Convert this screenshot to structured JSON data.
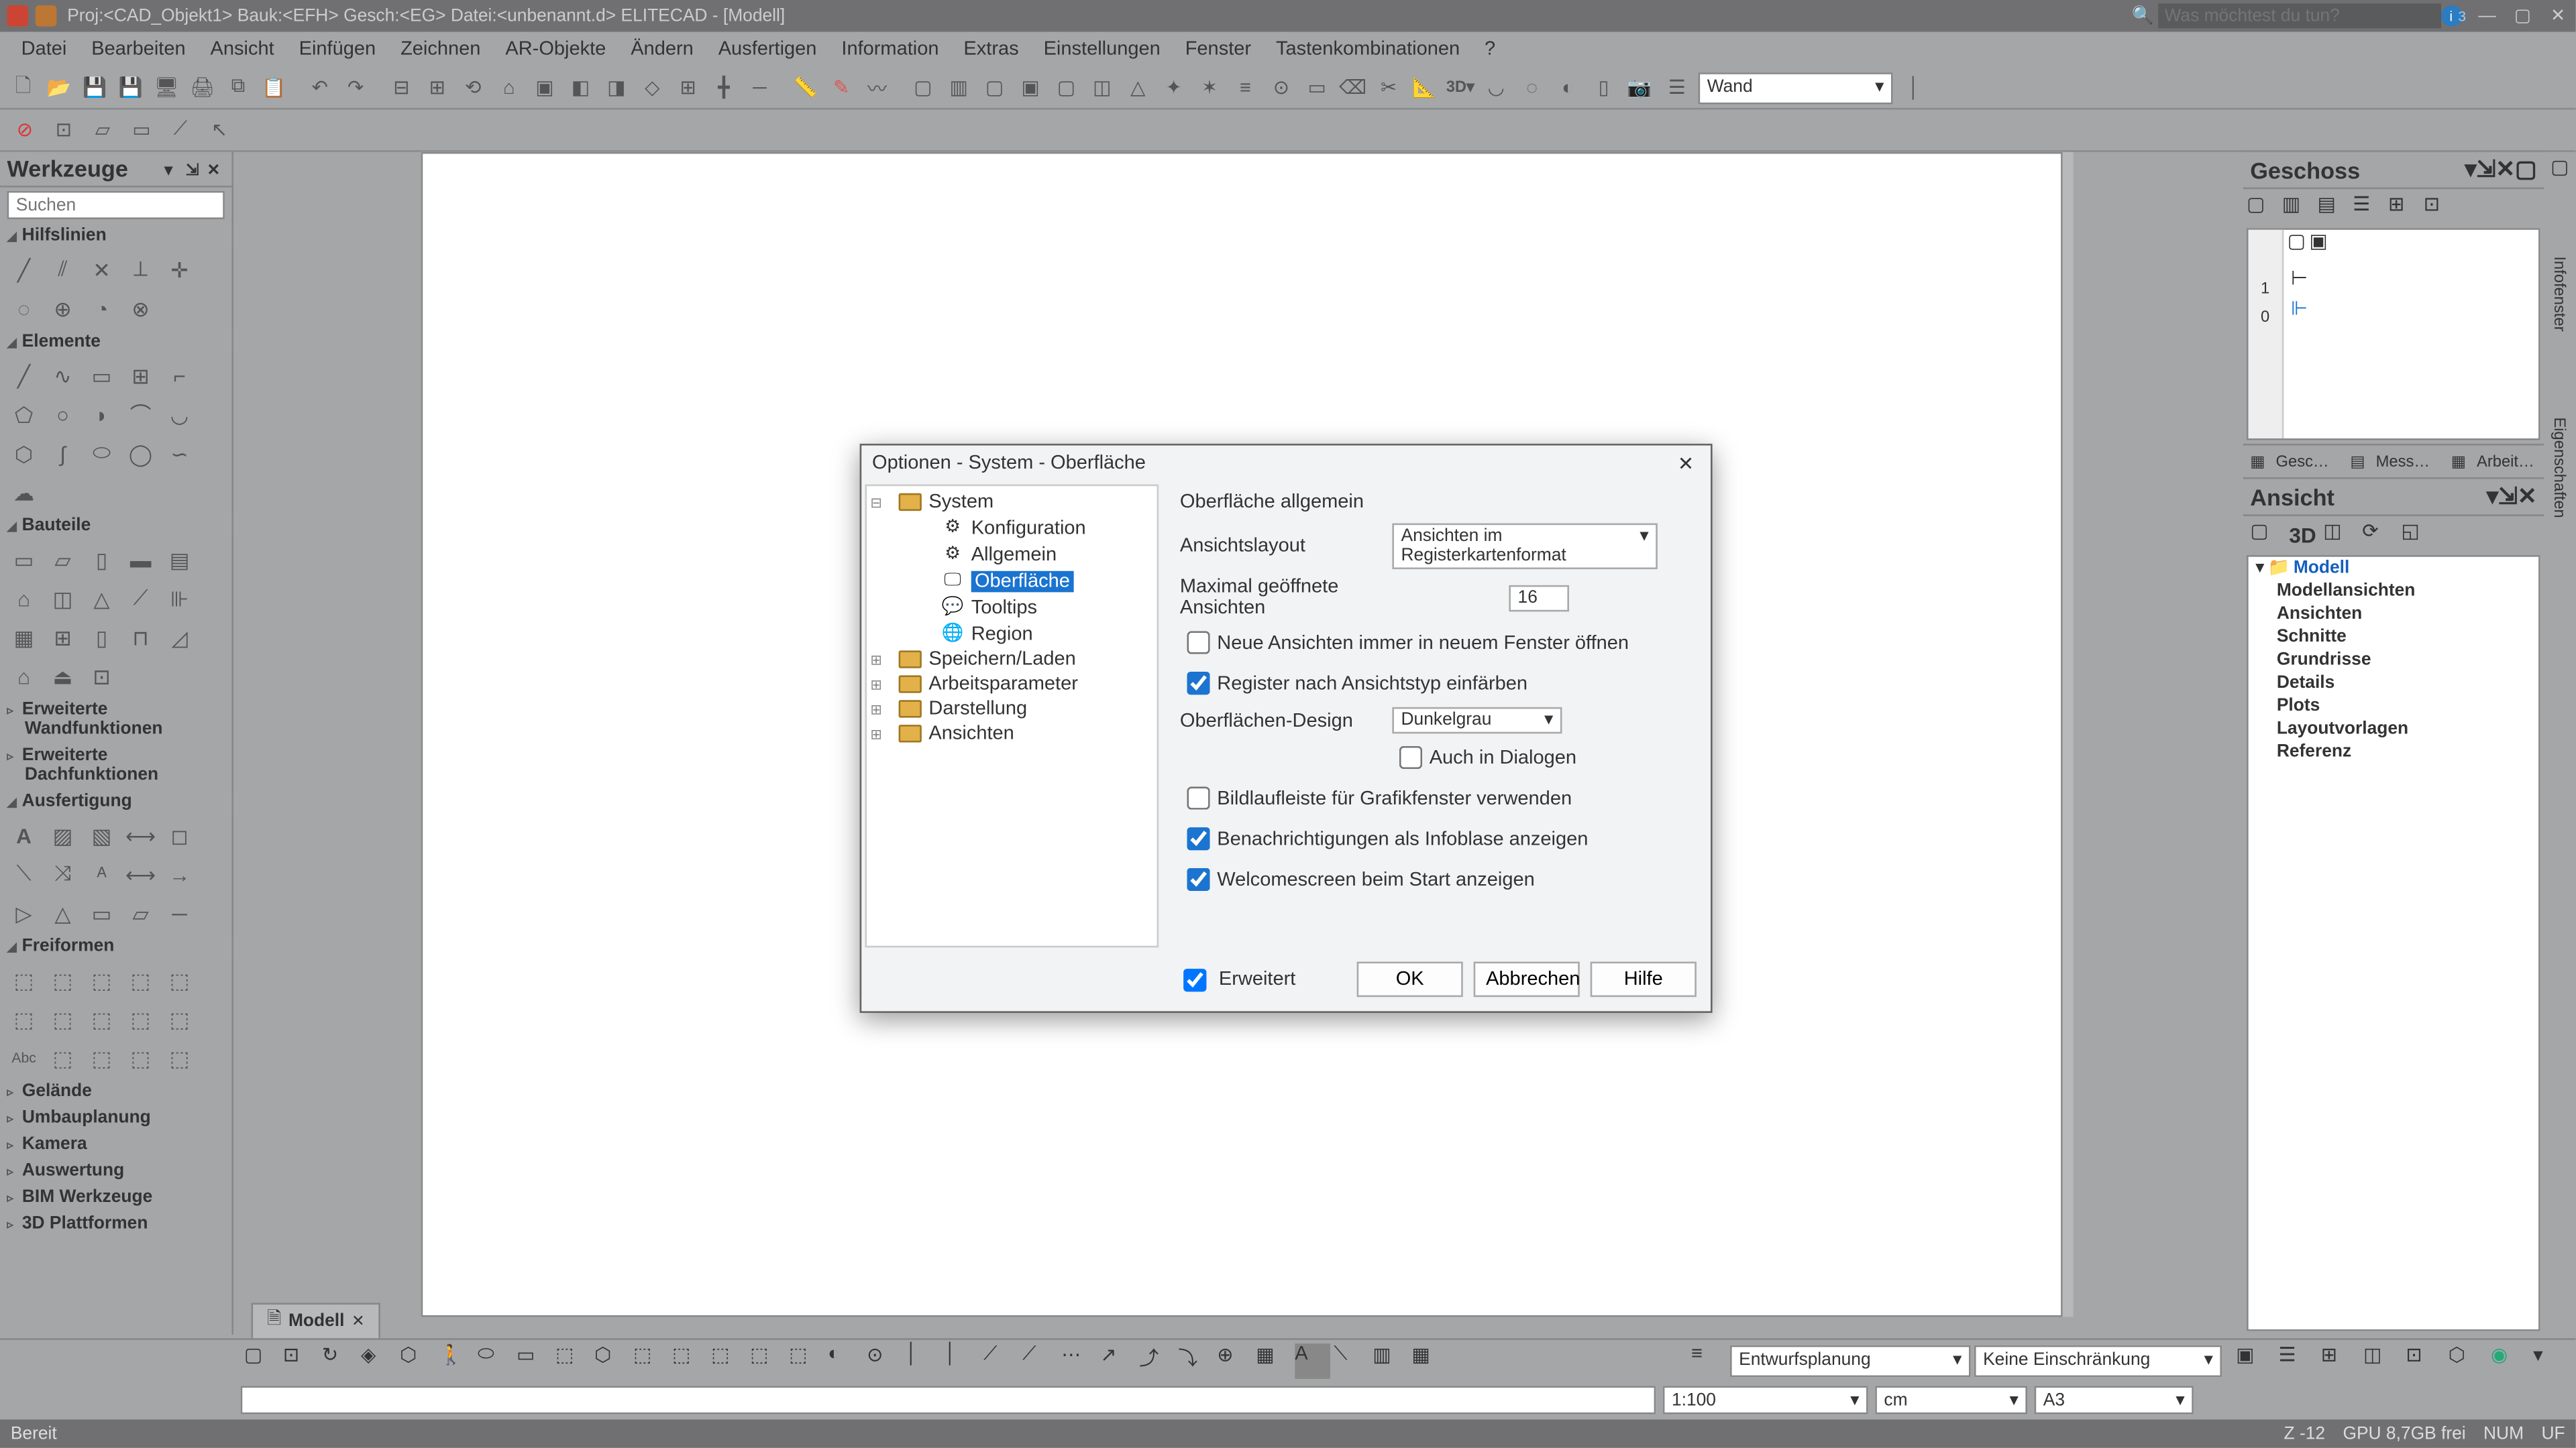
{
  "title": "Proj:<CAD_Objekt1>  Bauk:<EFH>  Gesch:<EG>  Datei:<unbenannt.d>  ELITECAD - [Modell]",
  "search_placeholder": "Was möchtest du tun?",
  "menu": [
    "Datei",
    "Bearbeiten",
    "Ansicht",
    "Einfügen",
    "Zeichnen",
    "AR-Objekte",
    "Ändern",
    "Ausfertigen",
    "Information",
    "Extras",
    "Einstellungen",
    "Fenster",
    "Tastenkombinationen",
    "?"
  ],
  "layer_combo": "Wand",
  "tools_panel": {
    "title": "Werkzeuge",
    "search_placeholder": "Suchen",
    "groups": {
      "hilfslinien": "Hilfslinien",
      "elemente": "Elemente",
      "bauteile": "Bauteile",
      "ausfertigung": "Ausfertigung",
      "freiformen": "Freiformen"
    },
    "cat_wall": "Erweiterte Wandfunktionen",
    "cat_roof": "Erweiterte Dachfunktionen",
    "collapsed": [
      "Gelände",
      "Umbauplanung",
      "Kamera",
      "Auswertung",
      "BIM Werkzeuge",
      "3D Plattformen"
    ]
  },
  "geschoss": {
    "title": "Geschoss",
    "levels": [
      "1",
      "0"
    ],
    "tabs": [
      "Gesc…",
      "Mess…",
      "Arbeit…"
    ]
  },
  "ansicht": {
    "title": "Ansicht",
    "threeD": "3D",
    "root": "Modell",
    "items": [
      "Modellansichten",
      "Ansichten",
      "Schnitte",
      "Grundrisse",
      "Details",
      "Plots",
      "Layoutvorlagen",
      "Referenz"
    ]
  },
  "side_tabs": [
    "Infofenster",
    "Eigenschaften"
  ],
  "doc_tab": "Modell",
  "dialog": {
    "title": "Optionen - System - Oberfläche",
    "tree": {
      "system": "System",
      "konfig": "Konfiguration",
      "allgemein": "Allgemein",
      "oberflaeche": "Oberfläche",
      "tooltips": "Tooltips",
      "region": "Region",
      "save": "Speichern/Laden",
      "arbeitsparam": "Arbeitsparameter",
      "darstellung": "Darstellung",
      "ansichten": "Ansichten"
    },
    "form": {
      "heading": "Oberfläche allgemein",
      "layout_label": "Ansichtslayout",
      "layout_value": "Ansichten im Registerkartenformat",
      "max_label": "Maximal geöffnete Ansichten",
      "max_value": "16",
      "chk_new": "Neue Ansichten immer in neuem Fenster öffnen",
      "chk_register": "Register nach Ansichtstyp einfärben",
      "design_label": "Oberflächen-Design",
      "design_value": "Dunkelgrau",
      "chk_dialogs": "Auch in Dialogen",
      "chk_scroll": "Bildlaufleiste für Grafikfenster verwenden",
      "chk_notif": "Benachrichtigungen als Infoblase anzeigen",
      "chk_welcome": "Welcomescreen beim Start anzeigen",
      "extended": "Erweitert",
      "ok": "OK",
      "cancel": "Abbrechen",
      "help": "Hilfe"
    }
  },
  "bottom": {
    "combo1": "Entwurfsplanung",
    "combo2": "Keine Einschränkung",
    "scale": "1:100",
    "unit": "cm",
    "paper": "A3"
  },
  "status": {
    "ready": "Bereit",
    "z": "Z -12",
    "gpu": "GPU 8,7GB frei",
    "num": "NUM",
    "uf": "UF"
  }
}
